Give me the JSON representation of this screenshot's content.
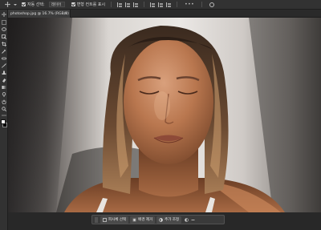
{
  "options_bar": {
    "move_tool_icon": "move-icon",
    "auto_select_label": "자동 선택:",
    "auto_select_value": "레이어",
    "transform_controls_label": "변형 컨트롤 표시",
    "align_icons": [
      "align-left-icon",
      "align-center-h-icon",
      "align-right-icon",
      "align-top-icon",
      "align-middle-icon",
      "align-bottom-icon"
    ],
    "more_label": "•••"
  },
  "document": {
    "tab_title": "photoshop.jpg @ 16.7% (RGB/8)",
    "close_glyph": "×"
  },
  "toolbar": {
    "tools": [
      "move-icon",
      "marquee-icon",
      "lasso-icon",
      "object-select-icon",
      "crop-icon",
      "frame-icon",
      "eyedropper-icon",
      "healing-brush-icon",
      "brush-icon",
      "clone-stamp-icon",
      "history-brush-icon",
      "eraser-icon",
      "gradient-icon",
      "blur-icon",
      "dodge-icon",
      "pen-icon",
      "type-icon",
      "path-select-icon",
      "rectangle-icon",
      "hand-icon",
      "zoom-icon",
      "more-tools-icon"
    ],
    "foreground_color": "#ffffff",
    "background_color": "#000000"
  },
  "context_bar": {
    "select_subject": "피사체 선택",
    "remove_background": "배경 제거",
    "more_label": "추가 조정"
  },
  "colors": {
    "panel": "#323232",
    "canvas_bg": "#282828",
    "accent": "#4a4a4a"
  }
}
